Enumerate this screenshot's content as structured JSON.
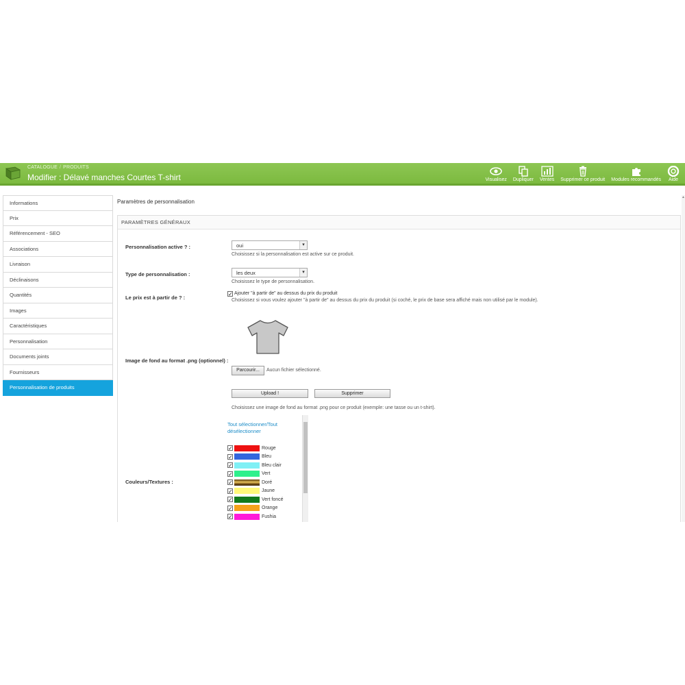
{
  "header": {
    "breadcrumb": [
      "CATALOGUE",
      "PRODUITS"
    ],
    "title": "Modifier : Délavé manches Courtes T-shirt",
    "toolbar": [
      {
        "label": "Visualisez",
        "icon": "eye-icon"
      },
      {
        "label": "Dupliquer",
        "icon": "copy-icon"
      },
      {
        "label": "Ventes",
        "icon": "bar-chart-icon"
      },
      {
        "label": "Supprimer ce produit",
        "icon": "trash-icon"
      },
      {
        "label": "Modules recommandés",
        "icon": "puzzle-icon"
      },
      {
        "label": "Aide",
        "icon": "lifebuoy-icon"
      }
    ]
  },
  "sidebar": {
    "items": [
      {
        "label": "Informations"
      },
      {
        "label": "Prix"
      },
      {
        "label": "Référencement - SEO"
      },
      {
        "label": "Associations"
      },
      {
        "label": "Livraison"
      },
      {
        "label": "Déclinaisons"
      },
      {
        "label": "Quantités"
      },
      {
        "label": "Images"
      },
      {
        "label": "Caractéristiques"
      },
      {
        "label": "Personnalisation"
      },
      {
        "label": "Documents joints"
      },
      {
        "label": "Fournisseurs"
      },
      {
        "label": "Personnalisation de produits",
        "active": true
      }
    ]
  },
  "main": {
    "section_title": "Paramètres de personnalisation",
    "panel_title": "PARAMÈTRES GÉNÉRAUX",
    "perso_active": {
      "label": "Personnalisation active ? :",
      "value": "oui",
      "hint": "Choisissez si la personnalisation est active sur ce produit."
    },
    "perso_type": {
      "label": "Type de personnalisation :",
      "value": "les deux",
      "hint": "Choisissez le type de personnalisation."
    },
    "price_from": {
      "label": "Le prix est à partir de ? :",
      "checkbox_label": "Ajouter \"à partir de\" au dessus du prix du produit",
      "checked": true,
      "hint": "Choisissez si vous voulez ajouter \"à partir de\" au dessus du prix du produit (si coché, le prix de base sera affiché mais non utilisé par le module)."
    },
    "background_image": {
      "label": "Image de fond au format .png (optionnel) :",
      "browse_label": "Parcourir...",
      "no_file": "Aucun fichier sélectionné.",
      "upload_label": "Upload !",
      "delete_label": "Supprimer",
      "hint": "Choisissez une image de fond au format .png pour ce produit (exemple: une tasse ou un t-shirt)."
    },
    "colors": {
      "label": "Couleurs/Textures :",
      "select_all": "Tout sélectionner/Tout désélectionner",
      "items": [
        {
          "name": "Rouge",
          "color": "#ee1111",
          "checked": true
        },
        {
          "name": "Bleu",
          "color": "#3366dd",
          "checked": true
        },
        {
          "name": "Bleu clair",
          "color": "#7ff0f5",
          "checked": true
        },
        {
          "name": "Vert",
          "color": "#2ef08c",
          "checked": true
        },
        {
          "name": "Doré",
          "color": "#9a7a2e",
          "checked": true
        },
        {
          "name": "Jaune",
          "color": "#fff97a",
          "checked": true
        },
        {
          "name": "Vert foncé",
          "color": "#127a1c",
          "checked": true
        },
        {
          "name": "Orange",
          "color": "#f5a21a",
          "checked": true
        },
        {
          "name": "Fushia",
          "color": "#ff1ad9",
          "checked": true
        }
      ]
    }
  }
}
